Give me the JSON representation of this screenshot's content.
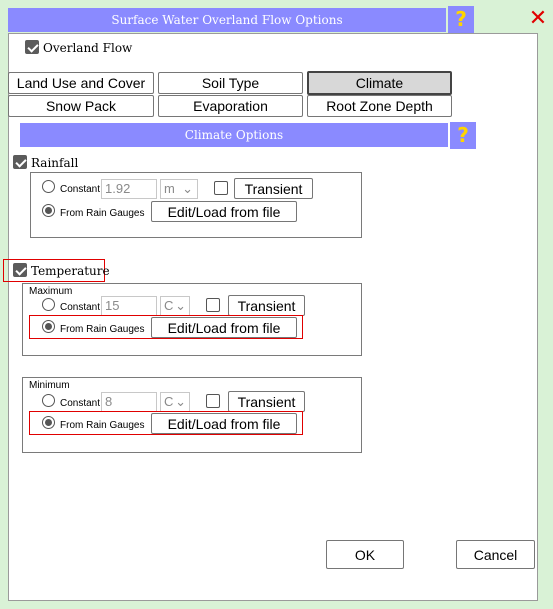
{
  "window": {
    "title": "Surface Water Overland Flow Options",
    "help_label": "?",
    "close_label": "✕"
  },
  "overland_flow": {
    "label": "Overland Flow",
    "checked": true
  },
  "tabs": [
    {
      "label": "Land Use and Cover"
    },
    {
      "label": "Soil Type"
    },
    {
      "label": "Climate",
      "active": true
    },
    {
      "label": "Snow Pack"
    },
    {
      "label": "Evaporation"
    },
    {
      "label": "Root Zone Depth"
    }
  ],
  "climate_options": {
    "title": "Climate Options",
    "help_label": "?"
  },
  "rainfall": {
    "label": "Rainfall",
    "constant_label": "Constant",
    "constant_value": "1.92",
    "unit": "m",
    "transient_label": "Transient",
    "gauges_label": "From Rain Gauges",
    "edit_label": "Edit/Load from file"
  },
  "temperature": {
    "label": "Temperature",
    "maximum": {
      "label": "Maximum",
      "constant_label": "Constant",
      "constant_value": "15",
      "unit": "C",
      "transient_label": "Transient",
      "gauges_label": "From Rain Gauges",
      "edit_label": "Edit/Load from file"
    },
    "minimum": {
      "label": "Minimum",
      "constant_label": "Constant",
      "constant_value": "8",
      "unit": "C",
      "transient_label": "Transient",
      "gauges_label": "From Rain Gauges",
      "edit_label": "Edit/Load from file"
    }
  },
  "footer": {
    "ok_label": "OK",
    "cancel_label": "Cancel"
  },
  "colors": {
    "title_bar": "#8a8aff",
    "help_mark": "#ffd400",
    "background": "#d9f2d6",
    "highlight": "#e00000"
  },
  "icons": [
    "help-icon",
    "close-icon",
    "checkbox-icon",
    "chevron-down-icon"
  ]
}
